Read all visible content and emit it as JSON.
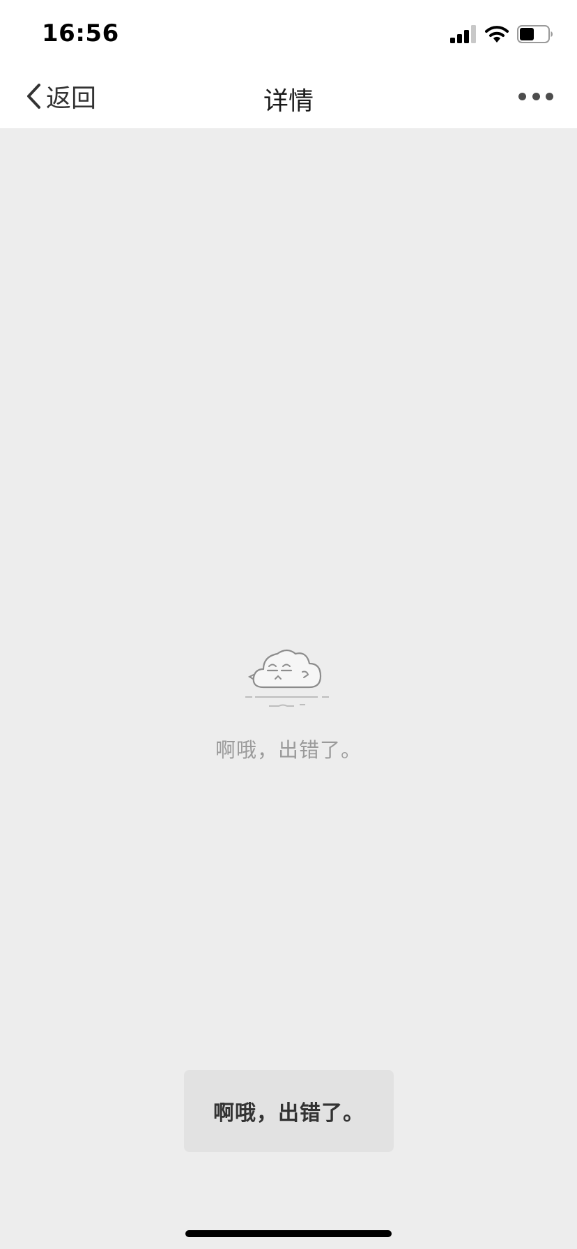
{
  "status_bar": {
    "time": "16:56",
    "icons": [
      "signal-icon",
      "wifi-icon",
      "battery-icon"
    ],
    "battery_level": 0.5
  },
  "nav": {
    "back_label": "返回",
    "title": "详情",
    "more_icon": "more-icon"
  },
  "content": {
    "illustration_icon": "cloud-icon",
    "error_message": "啊哦，出错了。"
  },
  "toast": {
    "text": "啊哦，出错了。"
  },
  "colors": {
    "page_background": "#ededed",
    "bar_background": "#ffffff",
    "toast_background": "#e2e2e2"
  }
}
